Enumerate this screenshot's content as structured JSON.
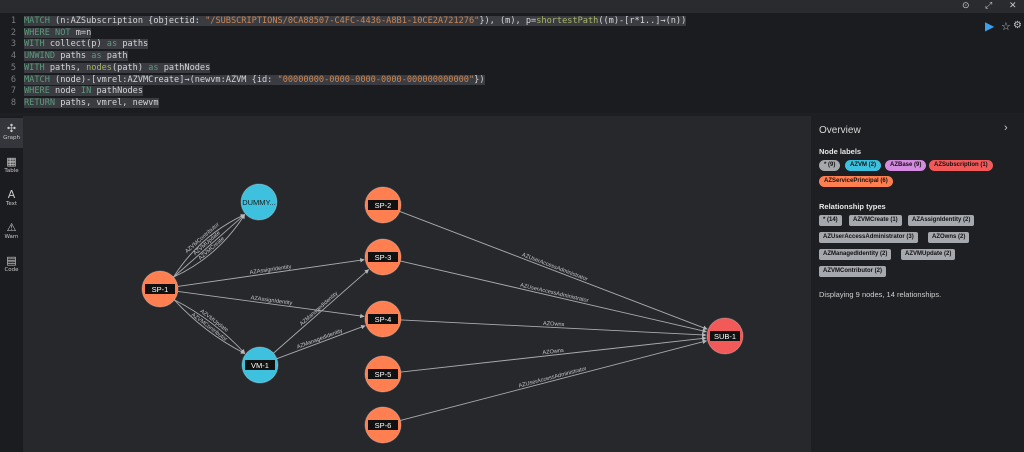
{
  "topbar": {
    "pin_icon": "pin-icon",
    "expand_icon": "expand-icon",
    "close_icon": "close-icon"
  },
  "editor": {
    "lines": [
      {
        "n": "1",
        "tokens": [
          [
            "kw",
            "MATCH "
          ],
          [
            "",
            "(n:AZSubscription {objectid: "
          ],
          [
            "str",
            "\"/SUBSCRIPTIONS/0CA88507-C4FC-4436-A8B1-10CE2A721276\""
          ],
          [
            "",
            "}), (m), p="
          ],
          [
            "fn",
            "shortestPath"
          ],
          [
            "",
            "((m)-[r*1..]→(n))"
          ]
        ]
      },
      {
        "n": "2",
        "tokens": [
          [
            "kw",
            "WHERE NOT "
          ],
          [
            "",
            "m=n"
          ]
        ]
      },
      {
        "n": "3",
        "tokens": [
          [
            "kw",
            "WITH "
          ],
          [
            "",
            "collect(p) "
          ],
          [
            "kw",
            "as "
          ],
          [
            "",
            "paths"
          ]
        ]
      },
      {
        "n": "4",
        "tokens": [
          [
            "kw",
            "UNWIND "
          ],
          [
            "",
            "paths "
          ],
          [
            "kw",
            "as "
          ],
          [
            "",
            "path"
          ]
        ]
      },
      {
        "n": "5",
        "tokens": [
          [
            "kw",
            "WITH "
          ],
          [
            "",
            "paths, "
          ],
          [
            "fn",
            "nodes"
          ],
          [
            "",
            "(path) "
          ],
          [
            "kw",
            "as "
          ],
          [
            "",
            "pathNodes"
          ]
        ]
      },
      {
        "n": "6",
        "tokens": [
          [
            "kw",
            "MATCH "
          ],
          [
            "",
            "(node)-[vmrel:AZVMCreate]→(newvm:AZVM {id: "
          ],
          [
            "str",
            "\"00000000-0000-0000-0000-000000000000\""
          ],
          [
            "",
            "})"
          ]
        ]
      },
      {
        "n": "7",
        "tokens": [
          [
            "kw",
            "WHERE "
          ],
          [
            "",
            "node "
          ],
          [
            "kw",
            "IN "
          ],
          [
            "",
            "pathNodes"
          ]
        ]
      },
      {
        "n": "8",
        "tokens": [
          [
            "kw",
            "RETURN "
          ],
          [
            "",
            "paths, vmrel, newvm"
          ]
        ]
      }
    ],
    "run_icon": "play-icon",
    "favorite_icon": "star-icon",
    "settings_icon": "gear-icon"
  },
  "nav": [
    {
      "label": "Graph",
      "icon": "graph-icon",
      "glyph": "✣"
    },
    {
      "label": "Table",
      "icon": "table-icon",
      "glyph": "▦"
    },
    {
      "label": "Text",
      "icon": "text-icon",
      "glyph": "A"
    },
    {
      "label": "Warn",
      "icon": "warning-icon",
      "glyph": "⚠"
    },
    {
      "label": "Code",
      "icon": "code-icon",
      "glyph": "▤"
    }
  ],
  "colors": {
    "sp": "#ff7f50",
    "vm": "#3ec1de",
    "sub": "#f25a5a",
    "base": "#d58be0",
    "any": "#a5a8ad"
  },
  "graph": {
    "nodes": [
      {
        "id": "SP-1",
        "label": "SP-1",
        "type": "sp"
      },
      {
        "id": "DUMMY",
        "label": "DUMMY...",
        "type": "vm"
      },
      {
        "id": "VM-1",
        "label": "VM-1",
        "type": "vm"
      },
      {
        "id": "SP-2",
        "label": "SP-2",
        "type": "sp"
      },
      {
        "id": "SP-3",
        "label": "SP-3",
        "type": "sp"
      },
      {
        "id": "SP-4",
        "label": "SP-4",
        "type": "sp"
      },
      {
        "id": "SP-5",
        "label": "SP-5",
        "type": "sp"
      },
      {
        "id": "SP-6",
        "label": "SP-6",
        "type": "sp"
      },
      {
        "id": "SUB-1",
        "label": "SUB-1",
        "type": "sub"
      }
    ],
    "edges": [
      {
        "from": "SP-1",
        "to": "DUMMY",
        "label": "AZVMContributor",
        "bend": -14
      },
      {
        "from": "SP-1",
        "to": "DUMMY",
        "label": "AZVMUpdate",
        "bend": 0
      },
      {
        "from": "SP-1",
        "to": "DUMMY",
        "label": "AZVMCreate",
        "bend": 14
      },
      {
        "from": "SP-1",
        "to": "SP-3",
        "label": "AZAssignIdentity",
        "bend": 0
      },
      {
        "from": "SP-1",
        "to": "SP-4",
        "label": "AZAssignIdentity",
        "bend": 0
      },
      {
        "from": "SP-1",
        "to": "VM-1",
        "label": "AZVMUpdate",
        "bend": -8
      },
      {
        "from": "SP-1",
        "to": "VM-1",
        "label": "AZVMContributor",
        "bend": 8
      },
      {
        "from": "VM-1",
        "to": "SP-3",
        "label": "AZManagedIdentity",
        "bend": 0
      },
      {
        "from": "VM-1",
        "to": "SP-4",
        "label": "AZManagedIdentity",
        "bend": 0
      },
      {
        "from": "SP-2",
        "to": "SUB-1",
        "label": "AZUserAccessAdministrator",
        "bend": 0
      },
      {
        "from": "SP-3",
        "to": "SUB-1",
        "label": "AZUserAccessAdministrator",
        "bend": 0
      },
      {
        "from": "SP-4",
        "to": "SUB-1",
        "label": "AZOwns",
        "bend": 0
      },
      {
        "from": "SP-5",
        "to": "SUB-1",
        "label": "AZOwns",
        "bend": 0
      },
      {
        "from": "SP-6",
        "to": "SUB-1",
        "label": "AZUserAccessAdministrator",
        "bend": 0
      }
    ]
  },
  "overview": {
    "title": "Overview",
    "collapse_icon": "chevron-right-icon",
    "node_labels_title": "Node labels",
    "node_labels": [
      {
        "text": "* (9)",
        "color": "any"
      },
      {
        "text": "AZVM (2)",
        "color": "vm"
      },
      {
        "text": "AZBase (9)",
        "color": "base"
      },
      {
        "text": "AZSubscription (1)",
        "color": "sub"
      },
      {
        "text": "AZServicePrincipal (6)",
        "color": "sp"
      }
    ],
    "rel_types_title": "Relationship types",
    "rel_types": [
      "* (14)",
      "AZVMCreate (1)",
      "AZAssignIdentity (2)",
      "AZUserAccessAdministrator (3)",
      "AZOwns (2)",
      "AZManagedIdentity (2)",
      "AZVMUpdate (2)",
      "AZVMContributor (2)"
    ],
    "summary": "Displaying 9 nodes, 14 relationships."
  }
}
